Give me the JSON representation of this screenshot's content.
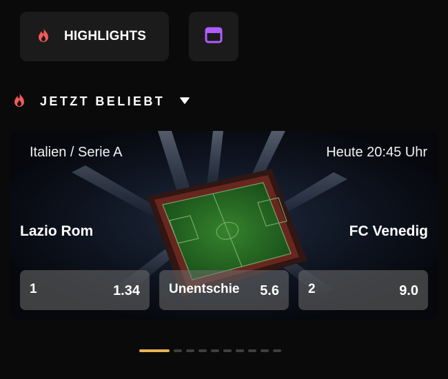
{
  "highlights_chip": {
    "label": "HIGHLIGHTS",
    "icon": "flame-icon",
    "icon_color": "#f25a5a"
  },
  "calendar_chip": {
    "icon": "calendar-icon",
    "icon_color": "#b05cff"
  },
  "section": {
    "title": "JETZT BELIEBT",
    "icon": "flame-icon",
    "caret_icon": "caret-down-icon"
  },
  "match": {
    "league": "Italien / Serie A",
    "time": "Heute 20:45 Uhr",
    "home_team": "Lazio Rom",
    "away_team": "FC Venedig",
    "odds": [
      {
        "label": "1",
        "value": "1.34"
      },
      {
        "label": "Unentschie",
        "value": "5.6"
      },
      {
        "label": "2",
        "value": "9.0"
      }
    ]
  },
  "carousel": {
    "total": 10,
    "active": 0,
    "active_color": "#e9b457"
  }
}
